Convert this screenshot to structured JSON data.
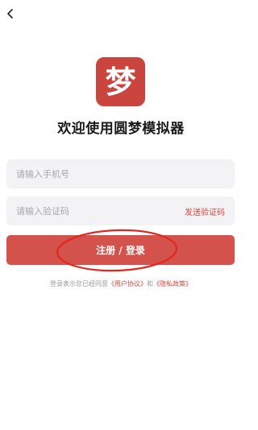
{
  "app": {
    "logo_char": "梦",
    "welcome_title": "欢迎使用圆梦模拟器"
  },
  "form": {
    "phone_placeholder": "请输入手机号",
    "code_placeholder": "请输入验证码",
    "send_code_label": "发送验证码",
    "submit_label": "注册 / 登录"
  },
  "agreement": {
    "prefix": "登录表示您已经同意",
    "user_agreement": "《用户协议》",
    "joiner": "和",
    "privacy_policy": "《隐私政策》"
  },
  "icons": {
    "back": "chevron-left-icon"
  },
  "colors": {
    "brand": "#c9453d",
    "button": "#d4524c",
    "link": "#d2463f",
    "annotation": "#e0281f"
  }
}
